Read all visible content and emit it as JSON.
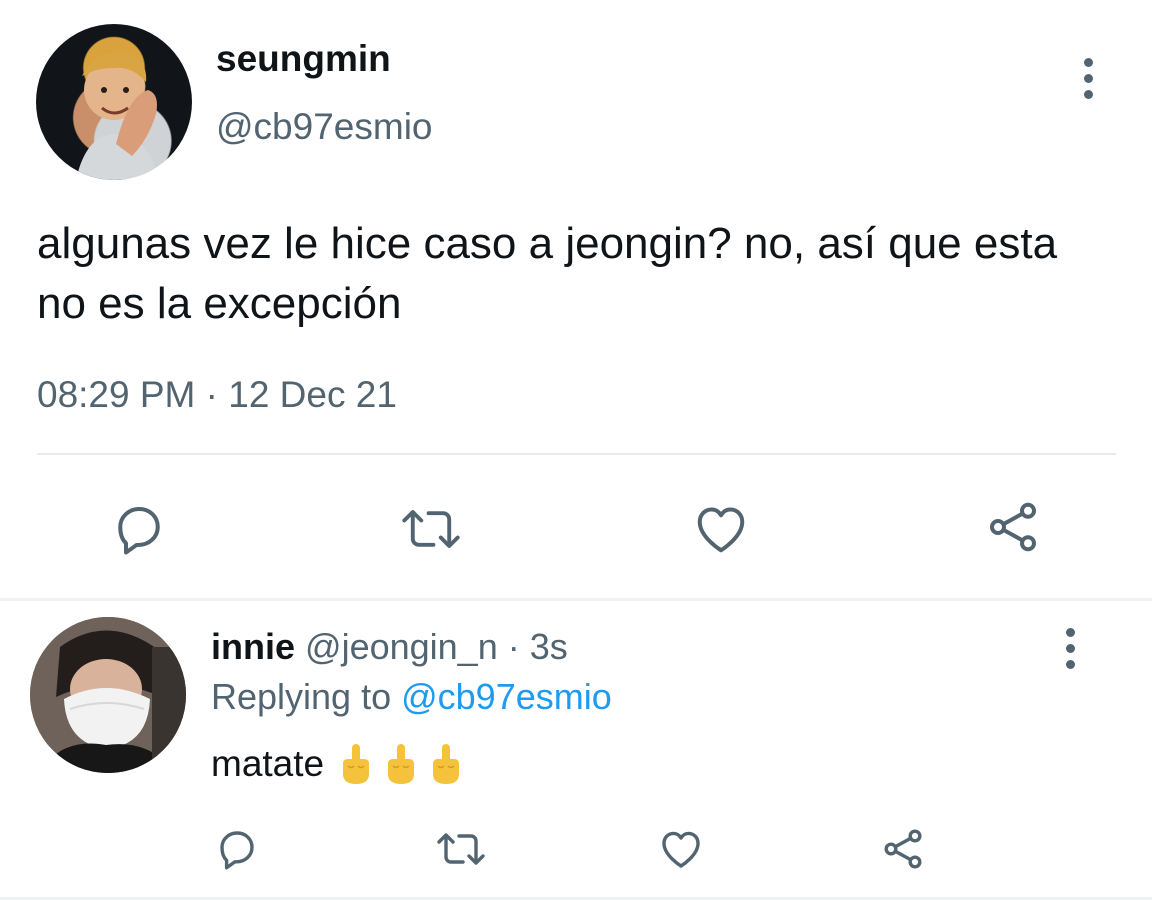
{
  "main_tweet": {
    "display_name": "seungmin",
    "handle": "@cb97esmio",
    "text": "algunas vez le hice caso a jeongin? no, así que esta no es la excepción",
    "timestamp": "08:29 PM · 12 Dec 21",
    "actions": [
      "reply-icon",
      "retweet-icon",
      "like-icon",
      "share-icon"
    ]
  },
  "reply": {
    "display_name": "innie",
    "handle": "@jeongin_n · 3s",
    "replying_prefix": "Replying to ",
    "replying_to": "@cb97esmio",
    "text": "matate",
    "emojis": [
      "middle-finger-emoji",
      "middle-finger-emoji",
      "middle-finger-emoji"
    ],
    "actions": [
      "reply-icon",
      "retweet-icon",
      "like-icon",
      "share-icon"
    ]
  },
  "colors": {
    "text": "#0f1419",
    "secondary": "#536471",
    "mention": "#1d9bf0",
    "divider": "#eff3f4",
    "emoji": "#f5c33b"
  }
}
